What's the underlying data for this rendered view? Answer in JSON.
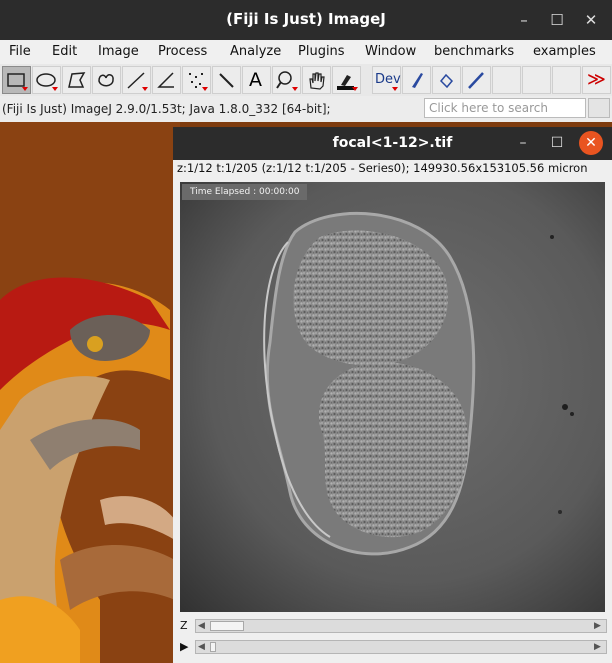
{
  "main_window": {
    "title": "(Fiji Is Just) ImageJ",
    "controls": {
      "minimize": "–",
      "maximize": "☐",
      "close": "✕"
    }
  },
  "menu": {
    "items": [
      "File",
      "Edit",
      "Image",
      "Process",
      "Analyze",
      "Plugins",
      "Window",
      "benchmarks",
      "examples"
    ]
  },
  "toolbar": {
    "tools": [
      {
        "name": "rectangle-tool",
        "icon": "rectangle-icon"
      },
      {
        "name": "oval-tool",
        "icon": "oval-icon"
      },
      {
        "name": "polygon-tool",
        "icon": "polygon-icon"
      },
      {
        "name": "freehand-tool",
        "icon": "freehand-icon"
      },
      {
        "name": "line-tool",
        "icon": "line-icon"
      },
      {
        "name": "angle-tool",
        "icon": "angle-icon"
      },
      {
        "name": "multipoint-tool",
        "icon": "multipoint-icon"
      },
      {
        "name": "wand-tool",
        "icon": "wand-icon"
      },
      {
        "name": "text-tool",
        "icon": "text-icon"
      },
      {
        "name": "zoom-tool",
        "icon": "magnifier-icon"
      },
      {
        "name": "hand-tool",
        "icon": "hand-icon"
      },
      {
        "name": "color-picker-tool",
        "icon": "dropper-icon"
      },
      {
        "name": "dev-tool",
        "icon": "dev-icon"
      },
      {
        "name": "brush-tool",
        "icon": "brush-icon"
      },
      {
        "name": "flood-fill-tool",
        "icon": "flood-fill-icon"
      },
      {
        "name": "pencil-tool",
        "icon": "pencil-icon"
      }
    ],
    "text_tool_label": "A",
    "dev_label": "Dev",
    "more_label": "≫"
  },
  "status": {
    "text": "(Fiji Is Just) ImageJ 2.9.0/1.53t; Java 1.8.0_332 [64-bit];"
  },
  "search": {
    "placeholder": "Click here to search"
  },
  "image_window": {
    "title": "focal<1-12>.tif",
    "info": "z:1/12 t:1/205 (z:1/12 t:1/205 - Series0); 149930.56x153105.56 micron",
    "overlay": "Time Elapsed : 00:00:00",
    "z_label": "Z",
    "t_label": "▶",
    "z_position": 0.0,
    "t_position": 0.0
  },
  "colors": {
    "titlebar": "#2c2c2c",
    "close_button": "#e95420",
    "wallpaper": "#7a3a10"
  }
}
